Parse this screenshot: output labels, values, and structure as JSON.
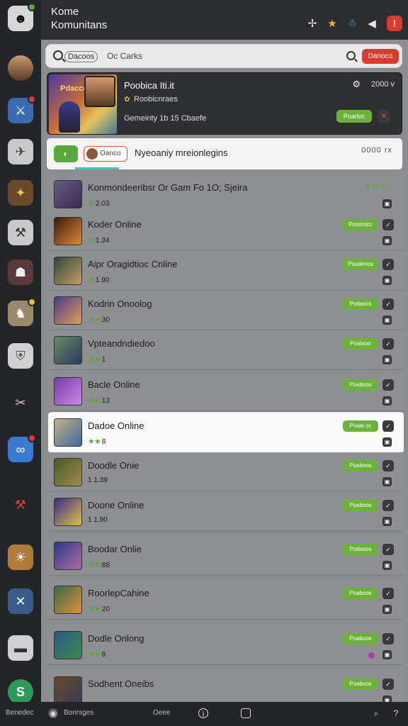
{
  "header": {
    "title": "Kome",
    "subtitle": "Komunitans"
  },
  "search": {
    "chip": "Dacoos",
    "placeholder": "Oc Carks",
    "red_button": "Danoco"
  },
  "featured": {
    "title": "Poobica Iti.it",
    "subtitle": "Roobicnraes",
    "meta": "Gemeinty 1b 15 Cbaefe",
    "right_label": "2000 v",
    "button": "Poarloc",
    "art_text": "Pdaccc"
  },
  "notice": {
    "pill": "Oanco",
    "text": "Nyeoaniy mreionlegins",
    "right": "0000 rx"
  },
  "list": [
    {
      "name": "Konmondeeribsr Or Gam Fo 1O; Sjeira",
      "rating": "2.03",
      "star_count": 1,
      "button": "",
      "top_stars": "★★ ✕"
    },
    {
      "name": "Koder Online",
      "rating": "1.34",
      "star_count": 1,
      "button": "Pooorocc"
    },
    {
      "name": "Aipr Oragidtioc Cnline",
      "rating": "1.90",
      "star_count": 1,
      "button": "Psodenos"
    },
    {
      "name": "Kodrin Onoolog",
      "rating": "30",
      "star_count": 2,
      "button": "Podasos"
    },
    {
      "name": "Vpteandndiedoo",
      "rating": "1",
      "star_count": 2,
      "button": "Poaboxr"
    },
    {
      "name": "Bacle Online",
      "rating": "13",
      "star_count": 2,
      "button": "Poaboos"
    },
    {
      "name": "Dadoe Online",
      "rating": "8",
      "star_count": 2,
      "button": "Poaie.oc"
    },
    {
      "name": "Doodle Onie",
      "rating": "1 1.39",
      "star_count": 0,
      "button": "Poaboos"
    },
    {
      "name": "Doone Online",
      "rating": "1 1.90",
      "star_count": 0,
      "button": "Poaboos"
    },
    {
      "name": "Boodar Onlie",
      "rating": "88",
      "star_count": 2,
      "button": "Podasos"
    },
    {
      "name": "RoorlepCahine",
      "rating": "20",
      "star_count": 2,
      "button": "Poaboos"
    },
    {
      "name": "Dodle Onlong",
      "rating": "8",
      "star_count": 2,
      "button": "Poaboos"
    },
    {
      "name": "Sodhent Oneibs",
      "rating": "",
      "star_count": 0,
      "button": "Poaboos"
    }
  ],
  "bottombar": {
    "left": "Benedec",
    "mid1": "Bonrsges",
    "mid2": "Oeee"
  },
  "colors": {
    "accent_green": "#6ab23a",
    "accent_red": "#d83b2f",
    "panel_grey": "#8e8f92",
    "dark": "#242528"
  }
}
